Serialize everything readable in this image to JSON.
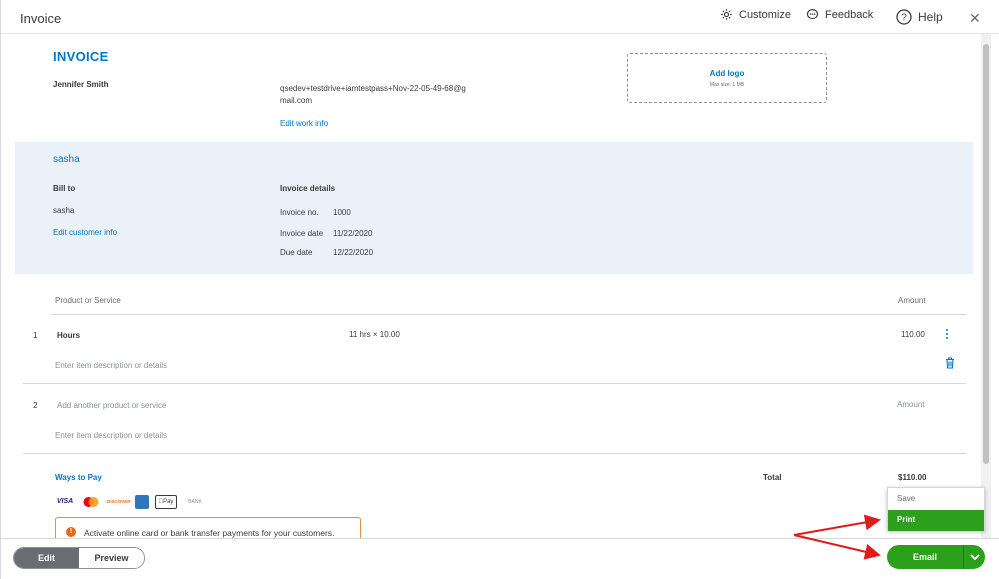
{
  "window": {
    "title": "Invoice",
    "close_glyph": "✕"
  },
  "toolbar": {
    "customize": "Customize",
    "feedback": "Feedback",
    "help": "Help"
  },
  "invoice": {
    "heading": "INVOICE",
    "company_name": "Jennifer Smith",
    "company_email": "qsedev+testdrive+iamtestpass+Nov-22-05-49-68@gmail.com",
    "edit_work_info": "Edit work info",
    "logo": {
      "label": "Add logo",
      "max_size": "Max size: 1 MB"
    }
  },
  "customer": {
    "name": "sasha",
    "bill_to_label": "Bill to",
    "bill_to_value": "sasha",
    "edit_customer_info": "Edit customer info"
  },
  "details": {
    "label": "Invoice details",
    "rows": [
      {
        "k": "Invoice no.",
        "v": "1000"
      },
      {
        "k": "Invoice date",
        "v": "11/22/2020"
      },
      {
        "k": "Due date",
        "v": "12/22/2020"
      }
    ]
  },
  "table": {
    "col_product": "Product or Service",
    "col_amount": "Amount",
    "line1": {
      "num": "1",
      "product": "Hours",
      "qty_rate": "11 hrs × 10.00",
      "amount": "110.00",
      "desc_placeholder": "Enter item description or details"
    },
    "line2": {
      "num": "2",
      "product_placeholder": "Add another product or service",
      "amount_placeholder": "Amount",
      "desc_placeholder": "Enter item description or details"
    }
  },
  "payment": {
    "ways_to_pay": "Ways to Pay",
    "total_label": "Total",
    "total_value": "$110.00",
    "icons": [
      "VISA",
      "mastercard-icon",
      "DISCOVER",
      "amex-icon",
      "Pay",
      "BANK"
    ],
    "alert": "Activate online card or bank transfer payments for your customers."
  },
  "footer": {
    "edit": "Edit",
    "preview": "Preview",
    "email": "Email",
    "menu": {
      "save": "Save",
      "print": "Print"
    }
  },
  "colors": {
    "brand_blue": "#0077c5",
    "green": "#2ca01c",
    "band": "#eaf1f8",
    "annotation_red": "#e01b1b"
  }
}
